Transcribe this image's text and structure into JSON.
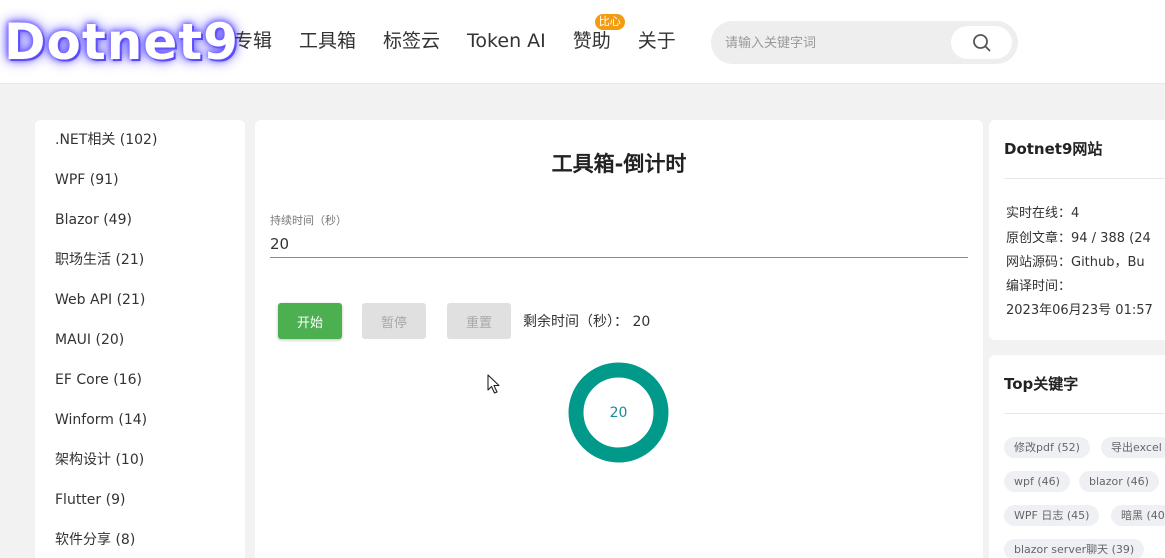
{
  "brand": {
    "logo": "Dotnet9"
  },
  "nav": {
    "items": [
      "专辑",
      "工具箱",
      "标签云",
      "Token AI",
      "赞助",
      "关于"
    ],
    "badge": "比心"
  },
  "search": {
    "placeholder": "请输入关键字词",
    "icon": "search-icon"
  },
  "sidebar": {
    "items": [
      ".NET相关 (102)",
      "WPF (91)",
      "Blazor (49)",
      "职场生活 (21)",
      "Web API (21)",
      "MAUI (20)",
      "EF Core (16)",
      "Winform (14)",
      "架构设计 (10)",
      "Flutter (9)",
      "软件分享 (8)"
    ]
  },
  "main": {
    "title": "工具箱-倒计时",
    "duration_label": "持续时间（秒）",
    "duration_value": "20",
    "start_label": "开始",
    "pause_label": "暂停",
    "reset_label": "重置",
    "remain_label": "剩余时间（秒）：",
    "remain_value": "20",
    "ring_value": "20",
    "ring_color": "#00998a"
  },
  "site": {
    "title": "Dotnet9网站",
    "online": "实时在线：4",
    "articles": "原创文章：94 / 388 (24",
    "source": "网站源码：Github，Bu",
    "build_label": "编译时间：",
    "build_time": "2023年06月23号 01:57"
  },
  "keywords": {
    "title": "Top关键字",
    "tags": [
      "修改pdf (52)",
      "导出excel",
      "wpf (46)",
      "blazor (46)",
      "WPF 日志 (45)",
      "暗黑 (40",
      "blazor server聊天 (39)"
    ]
  },
  "colors": {
    "accent_green": "#4caf50",
    "badge_orange": "#f39c12",
    "logo_glow": "#6b5cff"
  }
}
